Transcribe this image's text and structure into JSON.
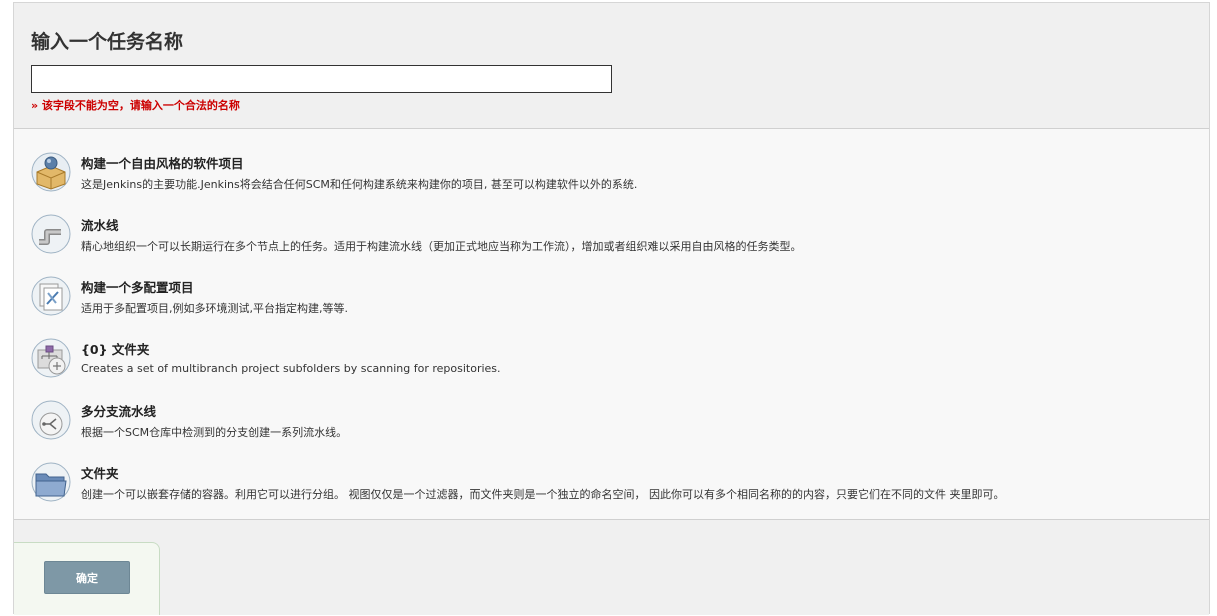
{
  "header": {
    "title": "输入一个任务名称",
    "name_input_value": "",
    "error_text": "» 该字段不能为空，请输入一个合法的名称"
  },
  "items": [
    {
      "icon": "freestyle-project-icon",
      "title": "构建一个自由风格的软件项目",
      "description": "这是Jenkins的主要功能.Jenkins将会结合任何SCM和任何构建系统来构建你的项目, 甚至可以构建软件以外的系统."
    },
    {
      "icon": "pipeline-icon",
      "title": "流水线",
      "description": "精心地组织一个可以长期运行在多个节点上的任务。适用于构建流水线（更加正式地应当称为工作流），增加或者组织难以采用自由风格的任务类型。"
    },
    {
      "icon": "multi-config-project-icon",
      "title": "构建一个多配置项目",
      "description": "适用于多配置项目,例如多环境测试,平台指定构建,等等."
    },
    {
      "icon": "organization-folder-icon",
      "title": "{0} 文件夹",
      "description": "Creates a set of multibranch project subfolders by scanning for repositories."
    },
    {
      "icon": "multibranch-pipeline-icon",
      "title": "多分支流水线",
      "description": "根据一个SCM仓库中检测到的分支创建一系列流水线。"
    },
    {
      "icon": "folder-icon",
      "title": "文件夹",
      "description": "创建一个可以嵌套存储的容器。利用它可以进行分组。 视图仅仅是一个过滤器，而文件夹则是一个独立的命名空间， 因此你可以有多个相同名称的的内容，只要它们在不同的文件 夹里即可。"
    }
  ],
  "footer": {
    "ok_label": "确定"
  },
  "colors": {
    "error": "#cc0000",
    "ok_button": "#7e98a6"
  }
}
